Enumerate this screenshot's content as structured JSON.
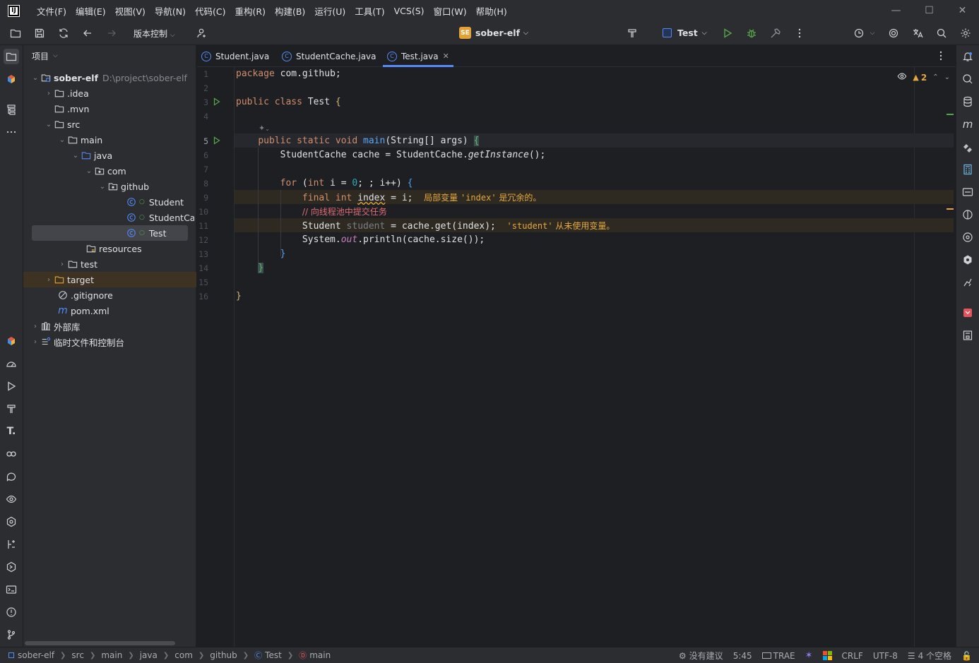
{
  "menubar": {
    "logo_text": "IJ",
    "items": [
      "文件(F)",
      "编辑(E)",
      "视图(V)",
      "导航(N)",
      "代码(C)",
      "重构(R)",
      "构建(B)",
      "运行(U)",
      "工具(T)",
      "VCS(S)",
      "窗口(W)",
      "帮助(H)"
    ]
  },
  "toolbar": {
    "vcs_label": "版本控制",
    "project_badge": "SE",
    "project_name": "sober-elf",
    "run_config": "Test"
  },
  "project_panel": {
    "header": "项目",
    "tree": [
      {
        "label": "sober-elf",
        "extra": "D:\\project\\sober-elf",
        "icon": "module-folder-icon"
      },
      {
        "label": ".idea",
        "icon": "folder-icon"
      },
      {
        "label": ".mvn",
        "icon": "folder-icon"
      },
      {
        "label": "src",
        "icon": "folder-icon"
      },
      {
        "label": "main",
        "icon": "folder-icon"
      },
      {
        "label": "java",
        "icon": "source-folder-icon"
      },
      {
        "label": "com",
        "icon": "package-icon"
      },
      {
        "label": "github",
        "icon": "package-icon"
      },
      {
        "label": "Student",
        "icon": "java-class-icon"
      },
      {
        "label": "StudentCache",
        "icon": "java-class-icon"
      },
      {
        "label": "Test",
        "icon": "java-class-icon"
      },
      {
        "label": "resources",
        "icon": "resources-folder-icon"
      },
      {
        "label": "test",
        "icon": "folder-icon"
      },
      {
        "label": "target",
        "icon": "excluded-folder-icon"
      },
      {
        "label": ".gitignore",
        "icon": "ignore-file-icon"
      },
      {
        "label": "pom.xml",
        "icon": "maven-icon"
      },
      {
        "label": "外部库",
        "icon": "library-icon"
      },
      {
        "label": "临时文件和控制台",
        "icon": "scratches-icon"
      }
    ]
  },
  "tabs": [
    {
      "label": "Student.java"
    },
    {
      "label": "StudentCache.java"
    },
    {
      "label": "Test.java",
      "active": true
    }
  ],
  "editor": {
    "warning_count": "2",
    "line_numbers": [
      "1",
      "2",
      "3",
      "4",
      "5",
      "6",
      "7",
      "8",
      "9",
      "10",
      "11",
      "12",
      "13",
      "14",
      "15",
      "16"
    ],
    "code": {
      "l1_kw": "package",
      "l1_rest": " com.github;",
      "l3_kw": "public class",
      "l3_name": " Test ",
      "l3_brace": "{",
      "l5_kw": "public static void",
      "l5_fn": "main",
      "l5_args": "(String[] args) ",
      "l5_brace": "{",
      "l6_a": "StudentCache cache = StudentCache.",
      "l6_fn": "getInstance",
      "l6_b": "();",
      "l8_kw": "for",
      "l8_a": " (",
      "l8_kw2": "int",
      "l8_b": " i = ",
      "l8_num": "0",
      "l8_c": "; ; i++) ",
      "l8_brace": "{",
      "l9_kw": "final int",
      "l9_var": "index",
      "l9_rest": " = i;",
      "l9_inlay_pre": "局部变量 ",
      "l9_inlay_name": "'index'",
      "l9_inlay_post": " 是冗余的。",
      "l10_comment": "// 向线程池中提交任务",
      "l11_type": "Student",
      "l11_var": " student",
      "l11_rest": " = cache.get(index);",
      "l11_inlay_name": "'student'",
      "l11_inlay_post": " 从未使用变量。",
      "l12_a": "System.",
      "l12_field": "out",
      "l12_b": ".println(cache.size());",
      "l13_brace": "}",
      "l14_brace": "}",
      "l16_brace": "}"
    }
  },
  "statusbar": {
    "crumbs": [
      "sober-elf",
      "src",
      "main",
      "java",
      "com",
      "github",
      "Test",
      "main"
    ],
    "no_suggestions": "没有建议",
    "position": "5:45",
    "trae": "TRAE",
    "line_ending": "CRLF",
    "encoding": "UTF-8",
    "indent": "4 个空格"
  }
}
